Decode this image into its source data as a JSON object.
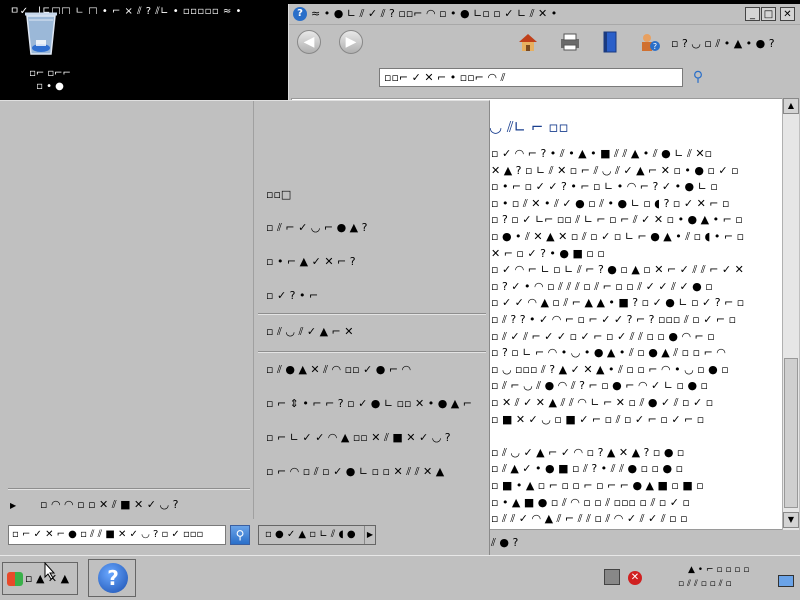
{
  "desktop": {
    "top_caption": "ㅁ✓ _|ㄷ□□ ㄴ □ • ⌐ × ⫽ ? ⫽∟ • ▫▫▫▫▫ ≈ •",
    "recycle_label_1": "▫⌐ ▫⌐⌐",
    "recycle_label_2": "▫ • ●"
  },
  "help_window": {
    "title_icon": "?",
    "title": "≈ • ● ∟ ⫽ ✓ ⫽ ? ▫▫⌐ ◠ ▫ • ● ∟▫ ▫ ✓ ∟ ⫽ ✕ •",
    "min_label": "_",
    "max_label": "□",
    "close_label": "✕",
    "back_glyph": "◀",
    "forward_glyph": "▶",
    "home_icon": "house-icon",
    "print_icon": "printer-icon",
    "browse_icon": "book-icon",
    "ask_icon": "ask-icon",
    "options_label": "▫ ? ◡ ▫ ⫽ • ▲ • ● ?",
    "search_value": "▫▫⌐ ✓ ✕ ⌐ • ▫▫⌐ ◠ ⫽",
    "heading": "◡ ⫽∟ ⌐ ▫▫",
    "lines": [
      "▫ ✓ ◠ ⌐ ? • ⫽ • ▲ • ■ ⫽ ⫽ ▲ • ⫽ ● ∟ ⫽ ✕▫",
      "✕ ▲ ? ▫ ∟ ⫽ ✕ ▫ ⌐ ⫽ ◡ ⫽ ✓ ▲ ⌐ ✕ ▫ • ● ▫ ✓ ▫",
      "▫ • ⌐ ▫ ✓ ✓ ? • ⌐ ▫ ∟ • ◠ ⌐ ? ✓ • ● ∟ ▫",
      "▫ • ▫ ⫽ ✕ • ⫽ ✓ ● ▫ ⫽ • ● ∟ ▫ ◖ ? ▫ ✓ ✕ ⌐ ▫",
      "▫ ? ▫ ✓ ∟⌐ ▫▫ ⫽ ∟ ⌐ ▫ ⌐ ⫽ ✓ ✕ ▫ • ● ▲ • ⌐ ▫",
      "▫ ● • ⫽ ✕ ▲ ✕ ▫ ⫽ ▫ ✓ ▫ ∟ ⌐ ● ▲ • ⫽ ▫ ◖ • ⌐ ▫",
      "✕ ⌐ ▫ ✓ ? • ● ■ ▫ ▫",
      "▫ ✓ ◠ ⌐ ∟ ▫ ∟ ⫽ ⌐ ? ● ▫ ▲ ▫ ✕ ⌐ ✓ ⫽ ⫽ ⌐ ✓ ✕",
      "▫ ? ✓ • ◠ ▫ ⫽ ⫽ ⫽ ▫ ⫽ ⌐ ▫ ▫ ⫽ ✓ ✓ ⫽ ✓ ● ▫",
      "▫ ✓ ✓ ◠ ▲ ▫ ⫽ ⌐ ▲ ▲ • ■ ? ▫ ✓ ● ∟ ▫ ✓ ? ⌐ ▫",
      "▫ ⫽ ? ? • ✓ ◠ ⌐ ▫ ⌐ ✓ ✓ ? ⌐ ? ▫▫▫ ⫽ ▫ ✓ ⌐ ▫",
      "▫ ⫽ ✓ ⫽ ⌐ ✓ ✓ ▫ ✓ ⌐ ▫ ✓ ⫽ ⫽ ▫ ▫ ● ◠ ⌐ ▫",
      "▫ ? ▫ ∟ ⌐ ◠ • ◡ • ● ▲ • ⫽ ▫ ● ▲ ⫽ ▫ ▫ ⌐ ◠",
      "▫ ◡ ▫▫▫ ⫽ ? ▲ ✓ ✕ ▲ • ⫽ ▫ ▫ ⌐ ◠ • ◡ ▫ ● ▫",
      "▫ ⫽ ⌐ ◡ ⫽ ● ◠ ⫽ ? ⌐ ▫ ● ⌐ ◠ ✓ ∟ ▫ ● ▫",
      "▫ ✕ ⫽ ✓ ✕ ▲ ⫽ ⫽ ◠ ∟ ⌐ ✕ ▫ ⫽ ● ✓ ⫽ ▫ ✓ ▫",
      "▫ ■ ✕ ✓ ◡ ▫ ■ ✓ ⌐ ▫ ⫽ ▫ ✓ ⌐ ▫ ✓ ⌐ ▫",
      "",
      "▫ ⫽ ◡ ✓ ▲ ⌐ ✓ ◠ ▫ ? ▲ ✕ ▲ ? ▫ ● ▫",
      "▫ ⫽ ▲ ✓ • ● ■ ▫ ⫽ ? • ⫽ ⫽ ● ▫ ▫ ● ▫",
      "▫ ■ • ▲ ▫ ⌐ ▫ ▫ ⌐ ▫ ⌐ ⌐ ● ▲ ■ ▫ ■ ▫",
      "▫ • ▲ ■ ● ▫ ⫽ ◠ ▫ ▫ ⫽ ▫▫▫ ▫ ⫽ ▫ ✓ ▫",
      "▫ ⫽ ⫽ ✓ ◠ ▲ ⫽ ⌐ ⫽ ⫽ ▫ ⫽ ◠ ✓ ⫽ ✓ ⫽ ▫ ▫"
    ],
    "status_text": "⫽ ● ?"
  },
  "start_menu": {
    "right_items": [
      "▫▫□",
      "▫ ⫽ ⌐ ✓ ◡ ⌐ ● ▲ ?",
      "▫ • ⌐ ▲ ✓ ✕ ⌐ ?",
      "▫ ✓ ? • ⌐",
      "▫ ⫽ ◡ ⫽ ✓ ▲ ⌐ ✕",
      "▫ ⫽ ● ▲ ✕ ⫽ ◠ ▫▫ ✓ ● ⌐ ◠",
      "▫ ⌐ ⇕ • ⌐ ⌐ ? ▫ ✓ ● ∟ ▫▫ ✕ • ● ▲ ⌐ ✕ ?",
      "▫ ⌐ ∟ ✓ ✓ ◠ ▲ ▫▫ ✕ ⫽ ■ ✕ ✓ ◡ ?",
      "▫ ⌐ ◠ ▫ ⫽ ▫ ✓ ● ∟ ▫ ▫ ✕ ⫽ ⫽ ✕ ▲"
    ],
    "all_programs_arrow": "▶",
    "all_programs": "▫ ◠ ◠ ▫ ▫ ✕ ⫽ ■ ✕ ✓ ◡ ?",
    "search_value": "▫ ⌐ ✓ ✕ ⌐ ● ▫ ⫽ ⫽ ■ ✕ ✓ ◡ ? ▫ ✓ ▫▫▫",
    "search_btn_glyph": "⚲",
    "power_label": "▫ ● ✓ ▲ ▫ ∟ ⫽ ◖ ●",
    "power_arrow": "▶"
  },
  "taskbar": {
    "start_label": "▫ ▲ ✕ ▲",
    "help_glyph": "?",
    "clock_line1": "▲ • ⌐ ▫ ▫ ▫ ▫",
    "clock_line2": "▫ ⫽ ⫽ ▫ ▫ ⫽ ▫"
  }
}
